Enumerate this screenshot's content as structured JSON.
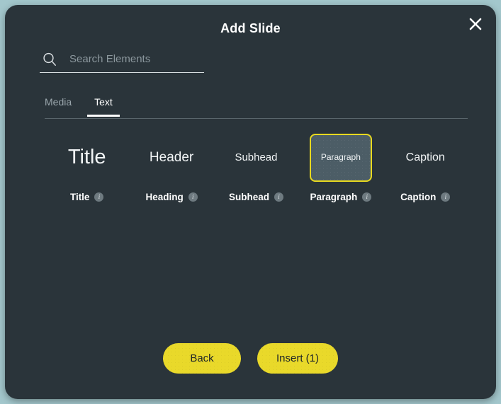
{
  "dialog": {
    "title": "Add Slide",
    "close_icon": "close-icon"
  },
  "search": {
    "icon": "search-icon",
    "placeholder": "Search Elements",
    "value": ""
  },
  "tabs": [
    {
      "label": "Media",
      "active": false
    },
    {
      "label": "Text",
      "active": true
    }
  ],
  "elements": [
    {
      "preview": "Title",
      "label": "Title",
      "size_class": "sz-title",
      "selected": false,
      "info_icon": "info-icon"
    },
    {
      "preview": "Header",
      "label": "Heading",
      "size_class": "sz-header",
      "selected": false,
      "info_icon": "info-icon"
    },
    {
      "preview": "Subhead",
      "label": "Subhead",
      "size_class": "sz-subhead",
      "selected": false,
      "info_icon": "info-icon"
    },
    {
      "preview": "Paragraph",
      "label": "Paragraph",
      "size_class": "sz-paragraph",
      "selected": true,
      "info_icon": "info-icon"
    },
    {
      "preview": "Caption",
      "label": "Caption",
      "size_class": "sz-caption",
      "selected": false,
      "info_icon": "info-icon"
    }
  ],
  "footer": {
    "back_label": "Back",
    "insert_label": "Insert (1)"
  },
  "colors": {
    "page_background": "#a3c7cc",
    "dialog_background": "#2a343a",
    "accent_yellow": "#e9d92a",
    "selected_tile_fill": "#4c5d66",
    "text_primary": "#ffffff",
    "text_muted": "#9aa6ac"
  }
}
